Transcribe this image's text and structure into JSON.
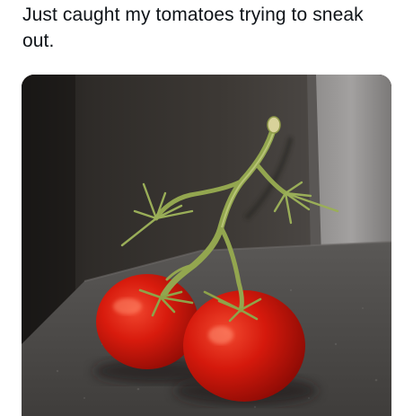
{
  "post": {
    "caption": "Just caught my tomatoes trying to sneak out."
  },
  "media": {
    "subject_icon": "tomato-vine-photo"
  },
  "colors": {
    "text": "#0f1419",
    "background": "#ffffff",
    "tomato_red": "#d2180e",
    "vine_green": "#8fa24b",
    "wall_dark": "#3a3633",
    "counter_gray": "#5e5c5a"
  }
}
